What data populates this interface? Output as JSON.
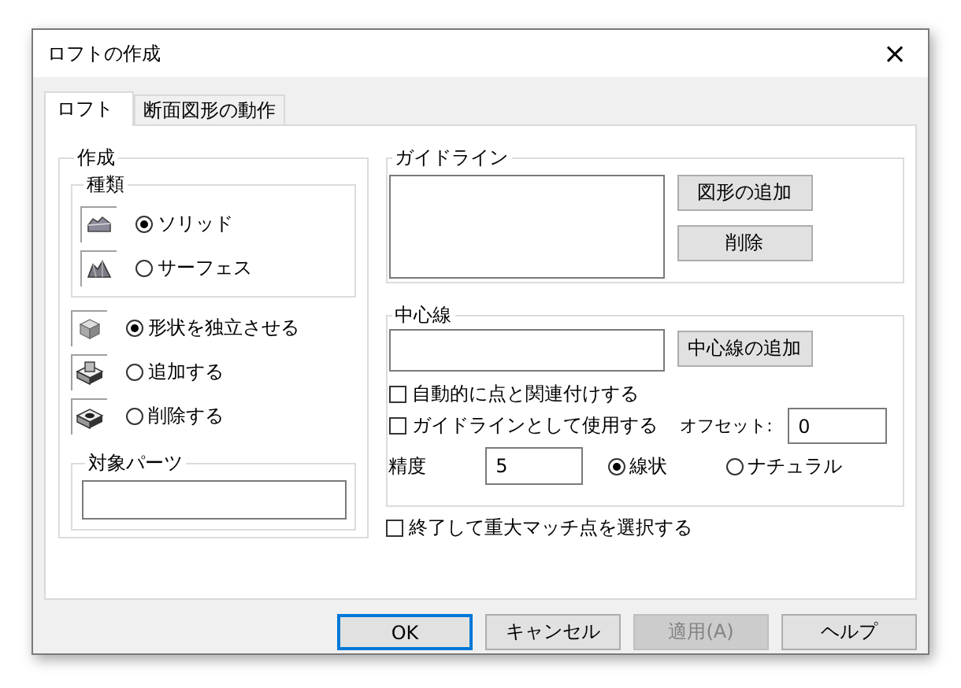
{
  "window": {
    "title": "ロフトの作成",
    "close": "×"
  },
  "tabs": [
    {
      "label": "ロフト",
      "selected": true
    },
    {
      "label": "断面図形の動作",
      "selected": false
    }
  ],
  "create": {
    "title": "作成",
    "type_group": {
      "title": "種類",
      "options": [
        {
          "label": "ソリッド",
          "selected": true,
          "kind": "solid"
        },
        {
          "label": "サーフェス",
          "selected": false,
          "kind": "surface"
        }
      ]
    },
    "operations": [
      {
        "label": "形状を独立させる",
        "selected": true,
        "kind": "new"
      },
      {
        "label": "追加する",
        "selected": false,
        "kind": "join"
      },
      {
        "label": "削除する",
        "selected": false,
        "kind": "cut"
      }
    ],
    "target": {
      "title": "対象パーツ"
    }
  },
  "guideline": {
    "title": "ガイドライン",
    "buttons": [
      "図形の追加",
      "削除"
    ]
  },
  "centerline": {
    "title": "中心線",
    "add_button": "中心線の追加",
    "checks": [
      {
        "label": "自動的に点と関連付けする",
        "checked": false
      },
      {
        "label": "ガイドラインとして使用する",
        "checked": false
      }
    ],
    "offset": {
      "label": "オフセット:",
      "value": "0"
    },
    "precision": {
      "label": "精度",
      "value": "5"
    },
    "modes": [
      {
        "label": "線状",
        "selected": true
      },
      {
        "label": "ナチュラル",
        "selected": false
      }
    ]
  },
  "finish_check": {
    "label": "終了して重大マッチ点を選択する",
    "checked": false
  },
  "buttons": [
    {
      "label": "OK",
      "kind": "default",
      "disabled": false
    },
    {
      "label": "キャンセル",
      "kind": "normal",
      "disabled": false
    },
    {
      "label": "適用(A)",
      "kind": "normal",
      "disabled": true
    },
    {
      "label": "ヘルプ",
      "kind": "normal",
      "disabled": false
    }
  ]
}
